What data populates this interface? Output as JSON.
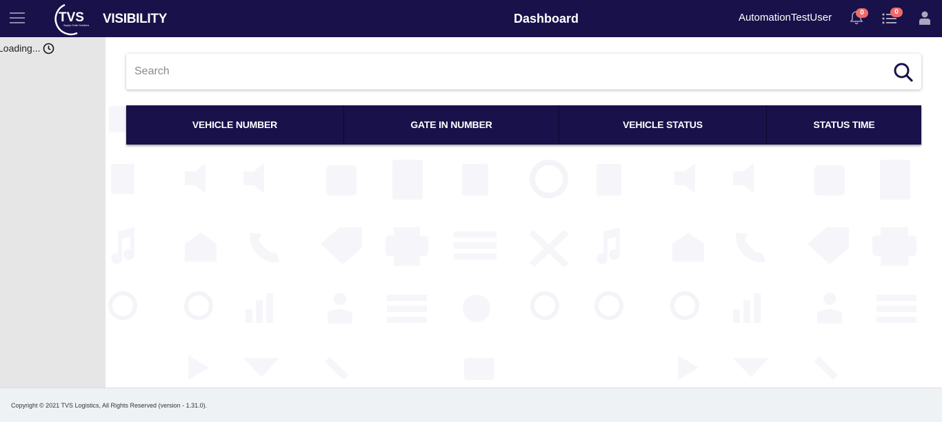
{
  "header": {
    "app_title": "VISIBILITY",
    "page_title": "Dashboard",
    "user_name": "AutomationTestUser",
    "notification_count": "0",
    "task_count": "0",
    "logo_text": "TVS",
    "logo_subtext": "Supply Chain Solutions",
    "brand_color": "#19114a",
    "badge_color": "#ef6a6a"
  },
  "sidebar": {
    "loading_text": "Loading..."
  },
  "search": {
    "placeholder": "Search",
    "value": ""
  },
  "table": {
    "columns": [
      "VEHICLE NUMBER",
      "GATE IN NUMBER",
      "VEHICLE STATUS",
      "STATUS TIME"
    ],
    "rows": []
  },
  "footer": {
    "copyright": "Copyright © 2021 TVS Logistics, All Rights Reserved (version - 1.31.0)."
  }
}
